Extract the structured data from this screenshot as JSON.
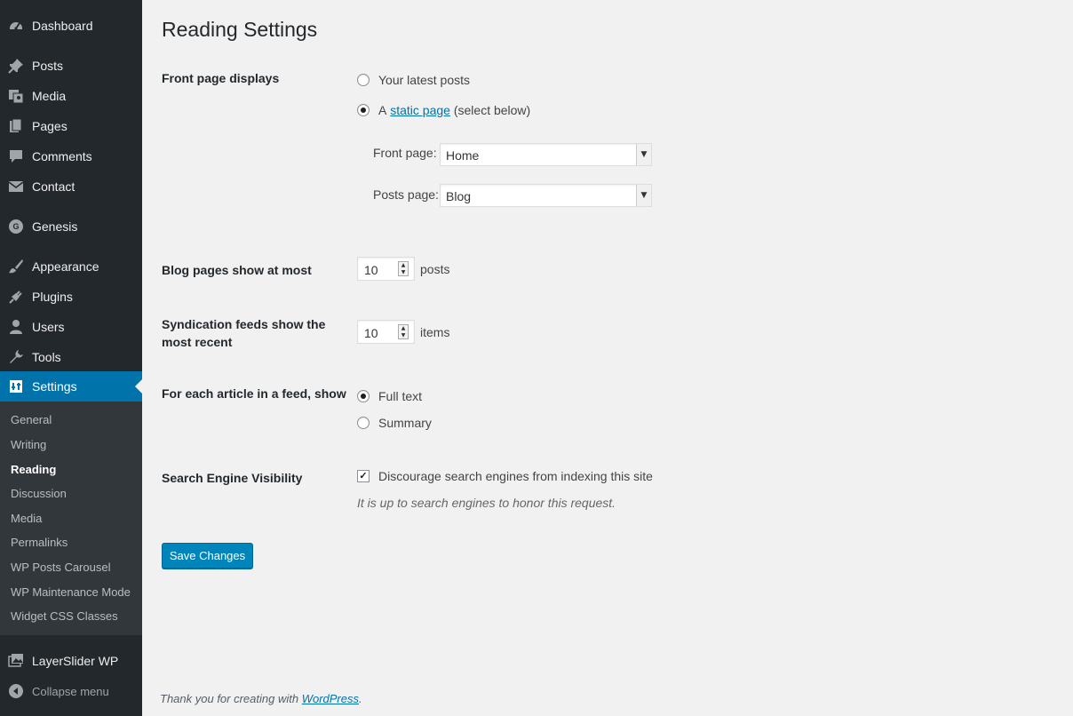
{
  "sidebar": {
    "items": [
      {
        "name": "dashboard",
        "label": "Dashboard",
        "icon": "dashboard-icon"
      },
      {
        "name": "posts",
        "label": "Posts",
        "icon": "pushpin-icon"
      },
      {
        "name": "media",
        "label": "Media",
        "icon": "media-icon"
      },
      {
        "name": "pages",
        "label": "Pages",
        "icon": "pages-icon"
      },
      {
        "name": "comments",
        "label": "Comments",
        "icon": "comment-icon"
      },
      {
        "name": "contact",
        "label": "Contact",
        "icon": "envelope-icon"
      },
      {
        "name": "genesis",
        "label": "Genesis",
        "icon": "genesis-icon",
        "icon_letter": "G"
      },
      {
        "name": "appearance",
        "label": "Appearance",
        "icon": "paintbrush-icon"
      },
      {
        "name": "plugins",
        "label": "Plugins",
        "icon": "plug-icon"
      },
      {
        "name": "users",
        "label": "Users",
        "icon": "user-icon"
      },
      {
        "name": "tools",
        "label": "Tools",
        "icon": "wrench-icon"
      },
      {
        "name": "settings",
        "label": "Settings",
        "icon": "settings-icon"
      },
      {
        "name": "layerslider",
        "label": "LayerSlider WP",
        "icon": "images-icon"
      },
      {
        "name": "collapse",
        "label": "Collapse menu",
        "icon": "collapse-arrow-icon"
      }
    ],
    "submenu": [
      "General",
      "Writing",
      "Reading",
      "Discussion",
      "Media",
      "Permalinks",
      "WP Posts Carousel",
      "WP Maintenance Mode",
      "Widget CSS Classes"
    ],
    "current_submenu": "Reading"
  },
  "page": {
    "title": "Reading Settings",
    "front_page_displays": {
      "label": "Front page displays",
      "option_latest": "Your latest posts",
      "option_static_prefix": "A",
      "option_static_link": "static page",
      "option_static_suffix": "(select below)",
      "selected": "static",
      "front_page_label": "Front page:",
      "front_page_value": "Home",
      "posts_page_label": "Posts page:",
      "posts_page_value": "Blog"
    },
    "blog_pages": {
      "label": "Blog pages show at most",
      "value": "10",
      "unit": "posts"
    },
    "syndication": {
      "label_line1": "Syndication feeds show the",
      "label_line2": "most recent",
      "value": "10",
      "unit": "items"
    },
    "feed_article": {
      "label": "For each article in a feed, show",
      "option_full": "Full text",
      "option_summary": "Summary",
      "selected": "full"
    },
    "search_visibility": {
      "label": "Search Engine Visibility",
      "checkbox_label": "Discourage search engines from indexing this site",
      "checked": true,
      "description": "It is up to search engines to honor this request."
    },
    "save_button": "Save Changes"
  },
  "footer": {
    "text_prefix": "Thank you for creating with",
    "link": "WordPress",
    "text_suffix": "."
  },
  "colors": {
    "sidebar_bg": "#23282d",
    "submenu_bg": "#32373c",
    "accent": "#0073aa",
    "button": "#0085ba",
    "content_bg": "#f1f1f1"
  }
}
